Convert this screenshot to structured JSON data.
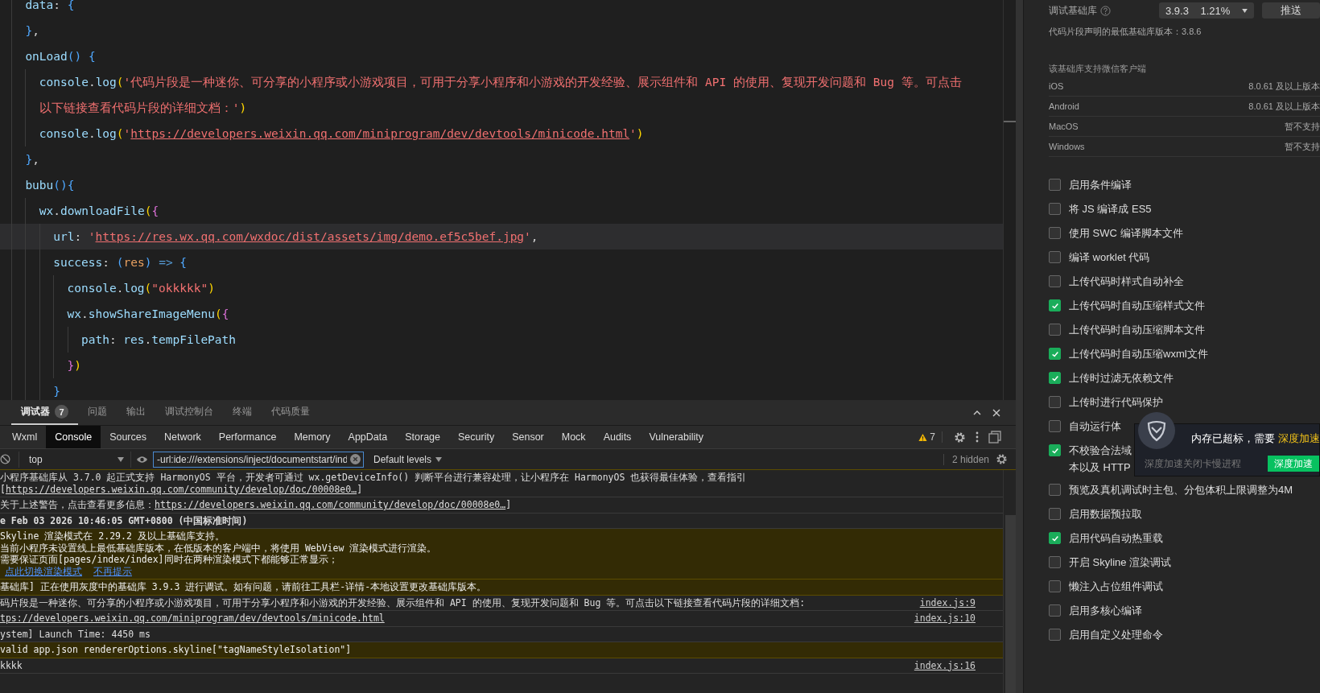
{
  "editor": {
    "lines": [
      {
        "highlighted": false,
        "segments": [
          {
            "text": "data",
            "kind": "fn"
          },
          {
            "text": ": ",
            "kind": "plain"
          },
          {
            "text": "{",
            "kind": "brace3"
          }
        ]
      },
      {
        "highlighted": false,
        "segments": [
          {
            "text": "}",
            "kind": "brace3"
          },
          {
            "text": ",",
            "kind": "plain"
          }
        ]
      },
      {
        "highlighted": false,
        "segments": [
          {
            "text": "onLoad",
            "kind": "fn"
          },
          {
            "text": "() {",
            "kind": "brace3"
          }
        ],
        "children": [
          {
            "highlighted": false,
            "segments": [
              {
                "text": "console",
                "kind": "fn"
              },
              {
                "text": ".",
                "kind": "plain"
              },
              {
                "text": "log",
                "kind": "fn"
              },
              {
                "text": "(",
                "kind": "brace1"
              },
              {
                "text": "'代码片段是一种迷你、可分享的小程序或小游戏项目，可用于分享小程序和小游戏的开发经验、展示组件和 API 的使用、复现开发问题和 Bug 等。可点击以下链接查看代码片段的详细文档：'",
                "kind": "str"
              },
              {
                "text": ")",
                "kind": "brace1"
              }
            ]
          },
          {
            "highlighted": false,
            "segments": [
              {
                "text": "console",
                "kind": "fn"
              },
              {
                "text": ".",
                "kind": "plain"
              },
              {
                "text": "log",
                "kind": "fn"
              },
              {
                "text": "(",
                "kind": "brace1"
              },
              {
                "text": "'",
                "kind": "str"
              },
              {
                "text": "https://developers.weixin.qq.com/miniprogram/dev/devtools/minicode.html",
                "kind": "link"
              },
              {
                "text": "'",
                "kind": "str"
              },
              {
                "text": ")",
                "kind": "brace1"
              }
            ]
          }
        ]
      },
      {
        "highlighted": false,
        "segments": [
          {
            "text": "}",
            "kind": "brace3"
          },
          {
            "text": ",",
            "kind": "plain"
          }
        ]
      },
      {
        "highlighted": false,
        "segments": [
          {
            "text": "bubu",
            "kind": "fn"
          },
          {
            "text": "(){",
            "kind": "brace3"
          }
        ],
        "children": [
          {
            "highlighted": false,
            "segments": [
              {
                "text": "wx",
                "kind": "fn"
              },
              {
                "text": ".",
                "kind": "plain"
              },
              {
                "text": "downloadFile",
                "kind": "fn"
              },
              {
                "text": "(",
                "kind": "brace1"
              },
              {
                "text": "{",
                "kind": "brace2"
              }
            ],
            "children": [
              {
                "highlighted": true,
                "segments": [
                  {
                    "text": "url",
                    "kind": "key"
                  },
                  {
                    "text": ": ",
                    "kind": "plain"
                  },
                  {
                    "text": "'",
                    "kind": "str"
                  },
                  {
                    "text": "https://res.wx.qq.com/wxdoc/dist/assets/img/demo.ef5c5bef.jpg",
                    "kind": "link"
                  },
                  {
                    "text": "'",
                    "kind": "str"
                  },
                  {
                    "text": ",",
                    "kind": "plain"
                  }
                ]
              },
              {
                "highlighted": false,
                "segments": [
                  {
                    "text": "success",
                    "kind": "key"
                  },
                  {
                    "text": ": ",
                    "kind": "plain"
                  },
                  {
                    "text": "(",
                    "kind": "brace3"
                  },
                  {
                    "text": "res",
                    "kind": "param"
                  },
                  {
                    "text": ")",
                    "kind": "brace3"
                  },
                  {
                    "text": " => ",
                    "kind": "op"
                  },
                  {
                    "text": "{",
                    "kind": "brace3"
                  }
                ],
                "children": [
                  {
                    "highlighted": false,
                    "segments": [
                      {
                        "text": "console",
                        "kind": "fn"
                      },
                      {
                        "text": ".",
                        "kind": "plain"
                      },
                      {
                        "text": "log",
                        "kind": "fn"
                      },
                      {
                        "text": "(",
                        "kind": "brace1"
                      },
                      {
                        "text": "\"okkkkk\"",
                        "kind": "str"
                      },
                      {
                        "text": ")",
                        "kind": "brace1"
                      }
                    ]
                  },
                  {
                    "highlighted": false,
                    "segments": [
                      {
                        "text": "wx",
                        "kind": "fn"
                      },
                      {
                        "text": ".",
                        "kind": "plain"
                      },
                      {
                        "text": "showShareImageMenu",
                        "kind": "fn"
                      },
                      {
                        "text": "(",
                        "kind": "brace1"
                      },
                      {
                        "text": "{",
                        "kind": "brace2"
                      }
                    ],
                    "children": [
                      {
                        "highlighted": false,
                        "segments": [
                          {
                            "text": "path",
                            "kind": "key"
                          },
                          {
                            "text": ": ",
                            "kind": "plain"
                          },
                          {
                            "text": "res",
                            "kind": "fn"
                          },
                          {
                            "text": ".",
                            "kind": "plain"
                          },
                          {
                            "text": "tempFilePath",
                            "kind": "fn"
                          }
                        ]
                      }
                    ]
                  },
                  {
                    "highlighted": false,
                    "segments": [
                      {
                        "text": "}",
                        "kind": "brace2"
                      },
                      {
                        "text": ")",
                        "kind": "brace1"
                      }
                    ]
                  }
                ]
              },
              {
                "highlighted": false,
                "segments": [
                  {
                    "text": "}",
                    "kind": "brace3"
                  }
                ]
              }
            ]
          }
        ]
      }
    ]
  },
  "panel_tabs": [
    {
      "label": "调试器",
      "badge": "7",
      "selected": true
    },
    {
      "label": "问题",
      "selected": false
    },
    {
      "label": "输出",
      "selected": false
    },
    {
      "label": "调试控制台",
      "selected": false
    },
    {
      "label": "终端",
      "selected": false
    },
    {
      "label": "代码质量",
      "selected": false
    }
  ],
  "devtools_tabs": [
    {
      "label": "Wxml",
      "selected": false
    },
    {
      "label": "Console",
      "selected": true
    },
    {
      "label": "Sources",
      "selected": false
    },
    {
      "label": "Network",
      "selected": false
    },
    {
      "label": "Performance",
      "selected": false
    },
    {
      "label": "Memory",
      "selected": false
    },
    {
      "label": "AppData",
      "selected": false
    },
    {
      "label": "Storage",
      "selected": false
    },
    {
      "label": "Security",
      "selected": false
    },
    {
      "label": "Sensor",
      "selected": false
    },
    {
      "label": "Mock",
      "selected": false
    },
    {
      "label": "Audits",
      "selected": false
    },
    {
      "label": "Vulnerability",
      "selected": false
    }
  ],
  "warning_count": "7",
  "console_toolbar": {
    "context": "top",
    "filter": "-url:ide:///extensions/inject/documentstart/ind",
    "levels": "Default levels",
    "hidden": "2 hidden"
  },
  "messages": [
    {
      "kind": "log",
      "bold": false,
      "lines": [
        [
          {
            "text": "小程序基础库从 3.7.0 起正式支持 HarmonyOS 平台，开发者可通过 wx.getDeviceInfo() 判断平台进行兼容处理，让小程序在 HarmonyOS 也获得最佳体验，查看指引[",
            "kind": "text"
          },
          {
            "text": "https://developers.weixin.qq.com/community/develop/doc/00008e0…",
            "kind": "link"
          },
          {
            "text": "]",
            "kind": "text"
          }
        ]
      ]
    },
    {
      "kind": "log",
      "bold": false,
      "lines": [
        [
          {
            "text": "关于上述警告，点击查看更多信息：",
            "kind": "text"
          },
          {
            "text": "https://developers.weixin.qq.com/community/develop/doc/00008e0…",
            "kind": "link"
          },
          {
            "text": "]",
            "kind": "text"
          }
        ]
      ]
    },
    {
      "kind": "log",
      "bold": true,
      "lines": [
        [
          {
            "text": "e Feb 03 2026 10:46:05 GMT+0800 (中国标准时间)",
            "kind": "text"
          }
        ]
      ]
    },
    {
      "kind": "warning",
      "bold": false,
      "lines": [
        [
          {
            "text": "Skyline 渲染模式在 2.29.2 及以上基础库支持。",
            "kind": "text"
          }
        ],
        [
          {
            "text": "当前小程序未设置线上最低基础库版本，在低版本的客户端中，将使用 WebView 渲染模式进行渲染。",
            "kind": "text"
          }
        ],
        [
          {
            "text": "需要保证页面[pages/index/index]同时在两种渲染模式下都能够正常显示；",
            "kind": "text"
          }
        ],
        [
          {
            "text": "点此切换渲染模式",
            "kind": "action"
          },
          {
            "text": "不再提示",
            "kind": "action"
          }
        ]
      ]
    },
    {
      "kind": "warning",
      "bold": false,
      "lines": [
        [
          {
            "text": "基础库] 正在使用灰度中的基础库 3.9.3 进行调试。如有问题，请前往工具栏-详情-本地设置更改基础库版本。",
            "kind": "text"
          }
        ]
      ]
    },
    {
      "kind": "log",
      "bold": false,
      "source": "index.js:9",
      "lines": [
        [
          {
            "text": "码片段是一种迷你、可分享的小程序或小游戏项目，可用于分享小程序和小游戏的开发经验、展示组件和 API 的使用、复现开发问题和 Bug 等。可点击以下链接查看代码片段的详细文档:",
            "kind": "text"
          }
        ]
      ]
    },
    {
      "kind": "log",
      "bold": false,
      "source": "index.js:10",
      "lines": [
        [
          {
            "text": "tps://developers.weixin.qq.com/miniprogram/dev/devtools/minicode.html",
            "kind": "link"
          }
        ]
      ]
    },
    {
      "kind": "log",
      "bold": false,
      "lines": [
        [
          {
            "text": "ystem] Launch Time: 4450 ms",
            "kind": "text"
          }
        ]
      ]
    },
    {
      "kind": "warning",
      "bold": false,
      "lines": [
        [
          {
            "text": "valid app.json rendererOptions.skyline[\"tagNameStyleIsolation\"]",
            "kind": "text"
          }
        ]
      ]
    },
    {
      "kind": "log",
      "bold": false,
      "source": "index.js:16",
      "lines": [
        [
          {
            "text": "kkkk",
            "kind": "text"
          }
        ]
      ]
    }
  ],
  "settings": {
    "library_label": "调试基础库",
    "library_version": "3.9.3",
    "library_share": "1.21%",
    "push_button": "推送",
    "min_version_note": "代码片段声明的最低基础库版本：3.8.6",
    "clients_title": "该基础库支持微信客户端",
    "clients": [
      {
        "platform": "iOS",
        "support": "8.0.61 及以上版本"
      },
      {
        "platform": "Android",
        "support": "8.0.61 及以上版本"
      },
      {
        "platform": "MacOS",
        "support": "暂不支持"
      },
      {
        "platform": "Windows",
        "support": "暂不支持"
      }
    ],
    "options": [
      {
        "label": "启用条件编译",
        "checked": false
      },
      {
        "label": "将 JS 编译成 ES5",
        "checked": false
      },
      {
        "label": "使用 SWC 编译脚本文件",
        "checked": false
      },
      {
        "label": "编译 worklet 代码",
        "checked": false
      },
      {
        "label": "上传代码时样式自动补全",
        "checked": false
      },
      {
        "label": "上传代码时自动压缩样式文件",
        "checked": true
      },
      {
        "label": "上传代码时自动压缩脚本文件",
        "checked": false
      },
      {
        "label": "上传代码时自动压缩wxml文件",
        "checked": true
      },
      {
        "label": "上传时过滤无依赖文件",
        "checked": true
      },
      {
        "label": "上传时进行代码保护",
        "checked": false
      },
      {
        "label": "自动运行体",
        "checked": false
      },
      {
        "label": "不校验合法域",
        "label_line_2": "本以及 HTTP",
        "checked": true
      },
      {
        "label": "预览及真机调试时主包、分包体积上限调整为4M",
        "checked": false
      },
      {
        "label": "启用数据预拉取",
        "checked": false
      },
      {
        "label": "启用代码自动热重载",
        "checked": true
      },
      {
        "label": "开启 Skyline 渲染调试",
        "checked": false
      },
      {
        "label": "懒注入占位组件调试",
        "checked": false
      },
      {
        "label": "启用多核心编译",
        "checked": false
      },
      {
        "label": "启用自定义处理命令",
        "checked": false
      }
    ]
  },
  "popup": {
    "message": "内存已超标，需要 ",
    "highlight": "深度加速",
    "hint": "深度加速关闭卡慢进程",
    "button": "深度加速"
  }
}
